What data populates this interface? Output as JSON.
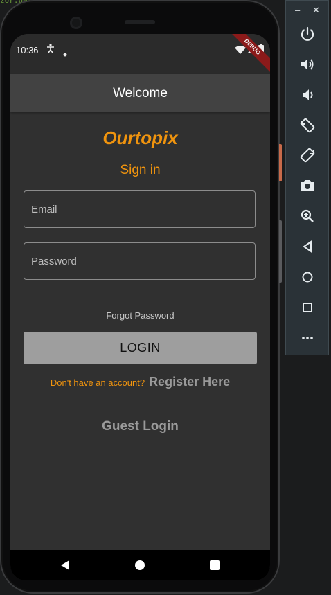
{
  "status_bar": {
    "time": "10:36",
    "debug_banner": "DEBUG"
  },
  "app_bar": {
    "title": "Welcome"
  },
  "login": {
    "brand": "Ourtopix",
    "heading": "Sign in",
    "email_placeholder": "Email",
    "password_placeholder": "Password",
    "forgot_password": "Forgot Password",
    "login_button": "LOGIN",
    "no_account": "Don't have an account?",
    "register_link": "Register Here",
    "guest_login": "Guest Login"
  },
  "toolbar": {
    "minimize": "–",
    "close": "✕",
    "items": [
      "power-icon",
      "volume-up-icon",
      "volume-down-icon",
      "rotate-left-icon",
      "rotate-right-icon",
      "camera-icon",
      "zoom-icon",
      "back-icon",
      "home-icon",
      "overview-icon",
      "more-icon"
    ]
  },
  "colors": {
    "accent": "#f0940e",
    "app_bar": "#424242",
    "background": "#303030",
    "button": "#9e9e9e"
  }
}
